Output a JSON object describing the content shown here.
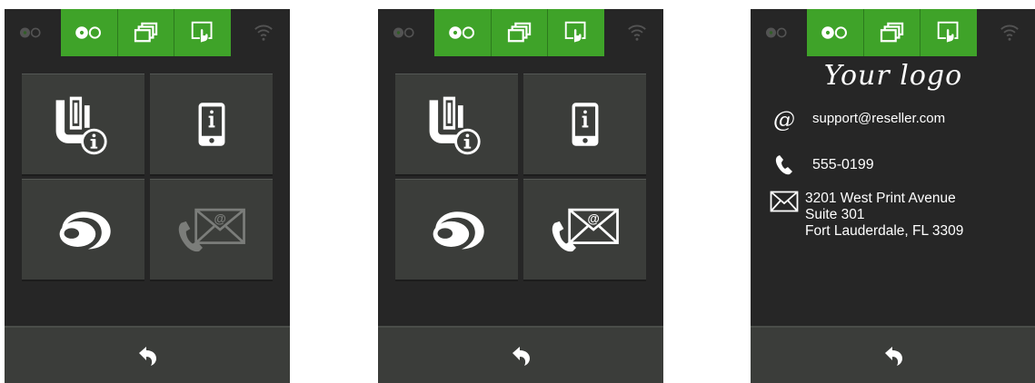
{
  "screens": [
    {
      "id": "support-menu",
      "tiles": [
        "printer-info",
        "device-info",
        "brand-logo",
        "contact-support"
      ],
      "contact_tile_enabled": false
    },
    {
      "id": "support-menu-active",
      "tiles": [
        "printer-info",
        "device-info",
        "brand-logo",
        "contact-support"
      ],
      "contact_tile_enabled": true
    },
    {
      "id": "contact-details"
    }
  ],
  "status_icons": [
    "tape-icon-dim",
    "tape-icon",
    "stack-icon",
    "touch-icon",
    "wifi-icon-dim"
  ],
  "contact": {
    "logo_text": "Your logo",
    "email": "support@reseller.com",
    "phone": "555-0199",
    "address_line1": "3201 West Print Avenue",
    "address_line2": "Suite 301",
    "address_line3": "Fort Lauderdale, FL 3309"
  },
  "colors": {
    "accent": "#3fa329",
    "background": "#262626",
    "tile": "#3b3d3a",
    "text": "#ffffff"
  }
}
